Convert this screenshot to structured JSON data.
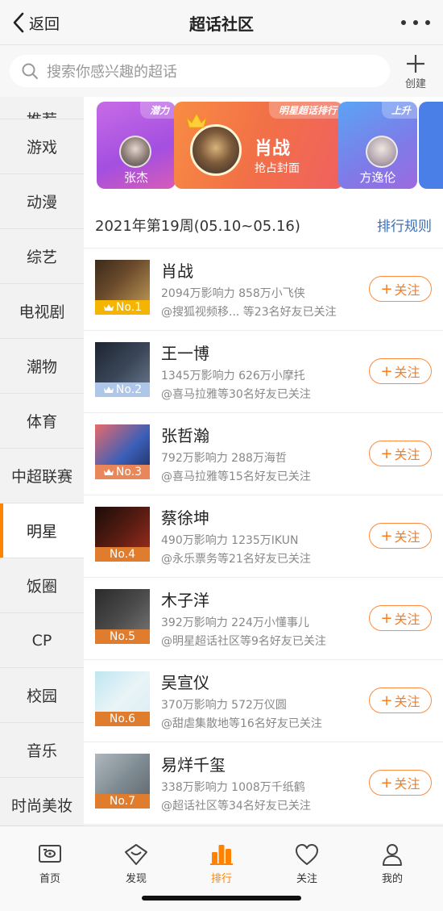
{
  "topbar": {
    "back_label": "返回",
    "title": "超话社区"
  },
  "search": {
    "placeholder": "搜索你感兴趣的超话",
    "create_label": "创建"
  },
  "sidebar": {
    "partial_label": "推荐",
    "items": [
      {
        "label": "游戏"
      },
      {
        "label": "动漫"
      },
      {
        "label": "综艺"
      },
      {
        "label": "电视剧"
      },
      {
        "label": "潮物"
      },
      {
        "label": "体育"
      },
      {
        "label": "中超联赛"
      },
      {
        "label": "明星",
        "active": true
      },
      {
        "label": "饭圈"
      },
      {
        "label": "CP"
      },
      {
        "label": "校园"
      },
      {
        "label": "音乐"
      },
      {
        "label": "时尚美妆"
      }
    ]
  },
  "banners": {
    "left": {
      "tag": "潜力",
      "name": "张杰"
    },
    "center": {
      "tag": "明星超话排行",
      "name": "肖战",
      "sub": "抢占封面"
    },
    "right": {
      "tag": "上升",
      "name": "方逸伦"
    }
  },
  "week": {
    "label": "2021年第19周(05.10~05.16)",
    "rules": "排行规则"
  },
  "follow_label": "关注",
  "rankings": [
    {
      "name": "肖战",
      "rank": "No.1",
      "stats": "2094万影响力 858万小飞侠",
      "friends": "@搜狐视频移... 等23名好友已关注",
      "rank_color": "#f5b400"
    },
    {
      "name": "王一博",
      "rank": "No.2",
      "stats": "1345万影响力 626万小摩托",
      "friends": "@喜马拉雅等30名好友已关注",
      "rank_color": "#aec7e8"
    },
    {
      "name": "张哲瀚",
      "rank": "No.3",
      "stats": "792万影响力 288万海哲",
      "friends": "@喜马拉雅等15名好友已关注",
      "rank_color": "#e9875a"
    },
    {
      "name": "蔡徐坤",
      "rank": "No.4",
      "stats": "490万影响力 1235万IKUN",
      "friends": "@永乐票务等21名好友已关注",
      "rank_color": "#e07c2e"
    },
    {
      "name": "木子洋",
      "rank": "No.5",
      "stats": "392万影响力 224万小懂事儿",
      "friends": "@明星超话社区等9名好友已关注",
      "rank_color": "#e07c2e"
    },
    {
      "name": "吴宣仪",
      "rank": "No.6",
      "stats": "370万影响力 572万仪圆",
      "friends": "@甜虐集散地等16名好友已关注",
      "rank_color": "#e07c2e"
    },
    {
      "name": "易烊千玺",
      "rank": "No.7",
      "stats": "338万影响力 1008万千纸鹤",
      "friends": "@超话社区等34名好友已关注",
      "rank_color": "#e07c2e"
    }
  ],
  "tabbar": {
    "items": [
      {
        "label": "首页",
        "icon": "home-icon"
      },
      {
        "label": "发现",
        "icon": "discover-icon"
      },
      {
        "label": "排行",
        "icon": "ranking-icon",
        "active": true
      },
      {
        "label": "关注",
        "icon": "heart-icon"
      },
      {
        "label": "我的",
        "icon": "profile-icon"
      }
    ]
  },
  "colors": {
    "accent": "#ff8200",
    "link": "#3d6fb6",
    "follow": "#ff7a1a"
  }
}
